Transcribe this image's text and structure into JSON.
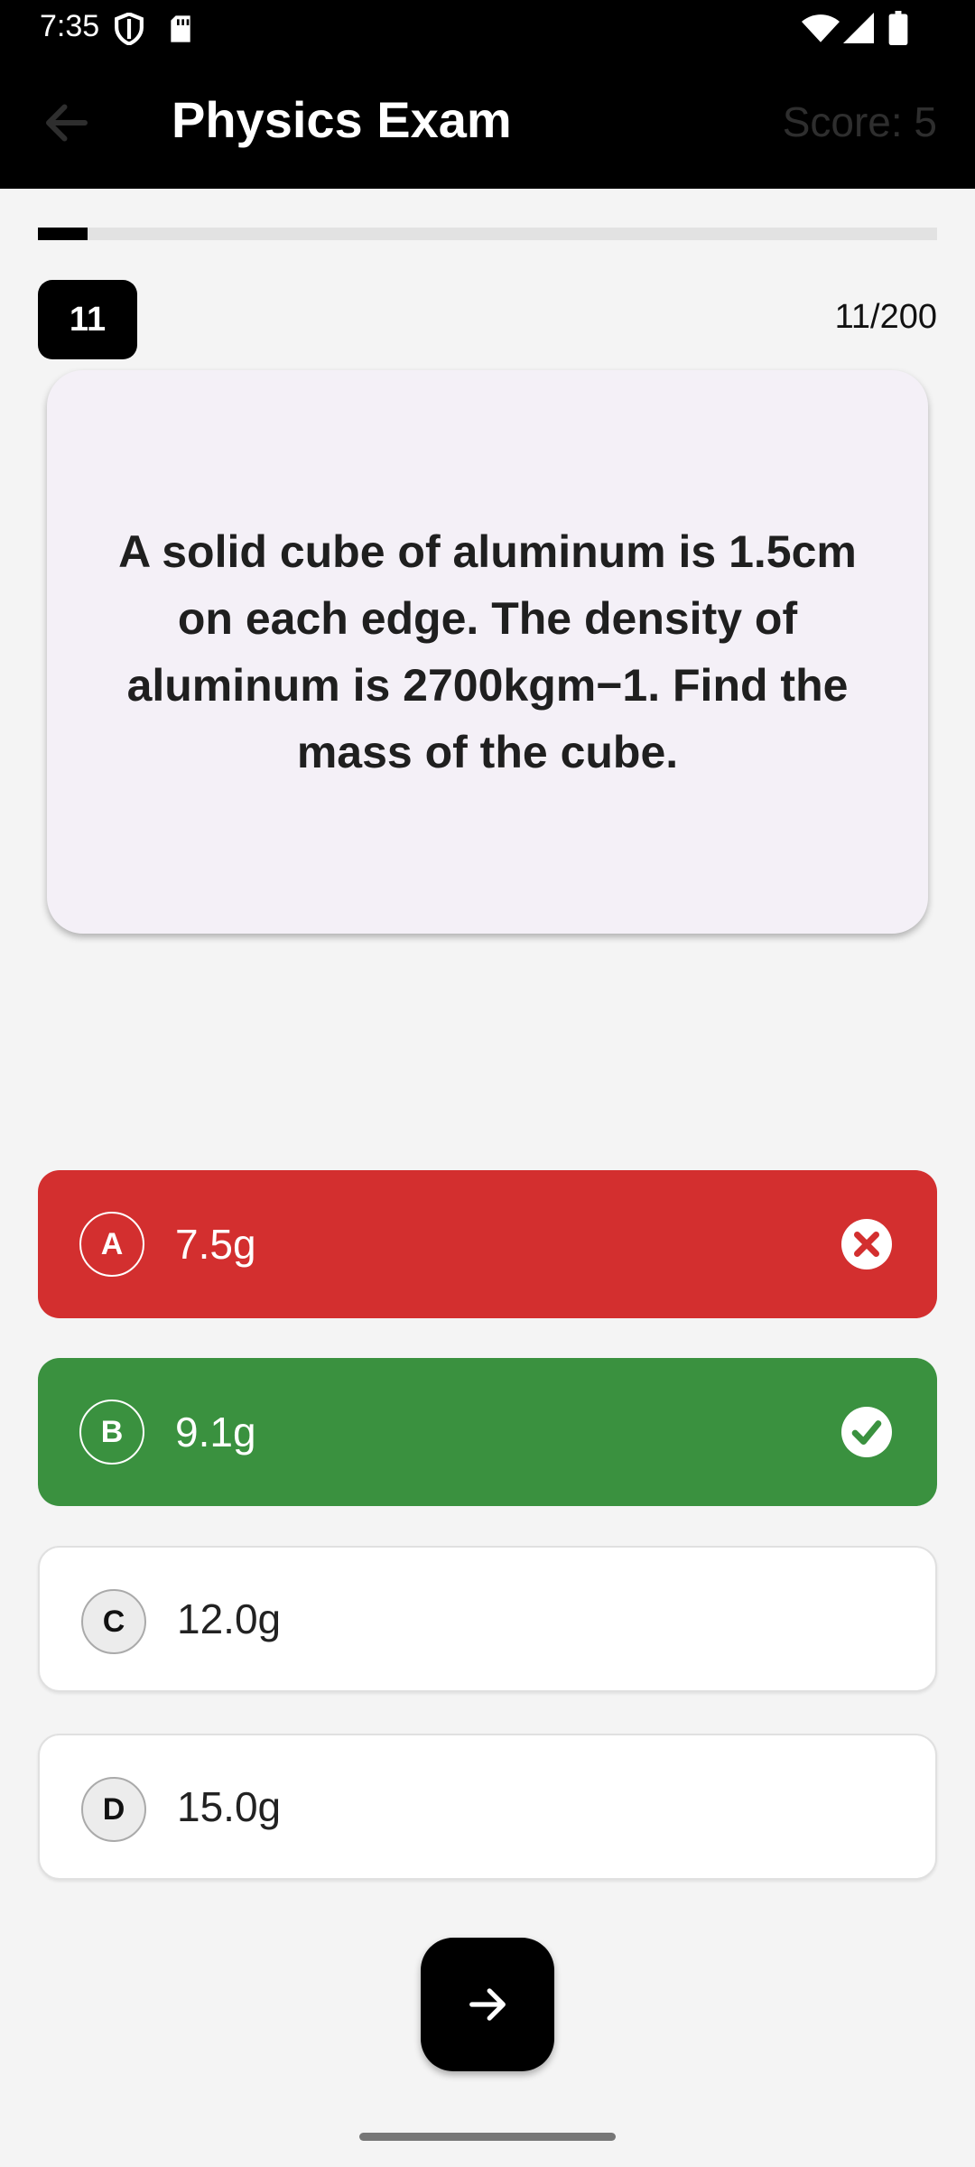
{
  "status_bar": {
    "time": "7:35",
    "icons": [
      "shield-icon",
      "sd-card-icon",
      "wifi-icon",
      "signal-icon",
      "battery-icon"
    ]
  },
  "app_bar": {
    "title": "Physics Exam",
    "score": "Score: 5",
    "back_icon": "arrow-back-icon"
  },
  "progress": {
    "current": 11,
    "total": 200,
    "fraction": 0.055,
    "badge": "11",
    "counter": "11/200"
  },
  "question": {
    "text": "A solid cube of aluminum is 1.5cm on each edge. The density of aluminum is 2700kgm−1. Find the mass of the cube."
  },
  "options": [
    {
      "letter": "A",
      "value": "7.5g",
      "state": "wrong",
      "icon": "close-circle-icon"
    },
    {
      "letter": "B",
      "value": "9.1g",
      "state": "correct",
      "icon": "check-circle-icon"
    },
    {
      "letter": "C",
      "value": "12.0g",
      "state": "neutral"
    },
    {
      "letter": "D",
      "value": "15.0g",
      "state": "neutral"
    }
  ],
  "next_button": {
    "icon": "arrow-forward-icon"
  },
  "colors": {
    "wrong": "#d32f2f",
    "correct": "#3a913f",
    "app_bar": "#000000",
    "card": "#f4f0f7"
  }
}
